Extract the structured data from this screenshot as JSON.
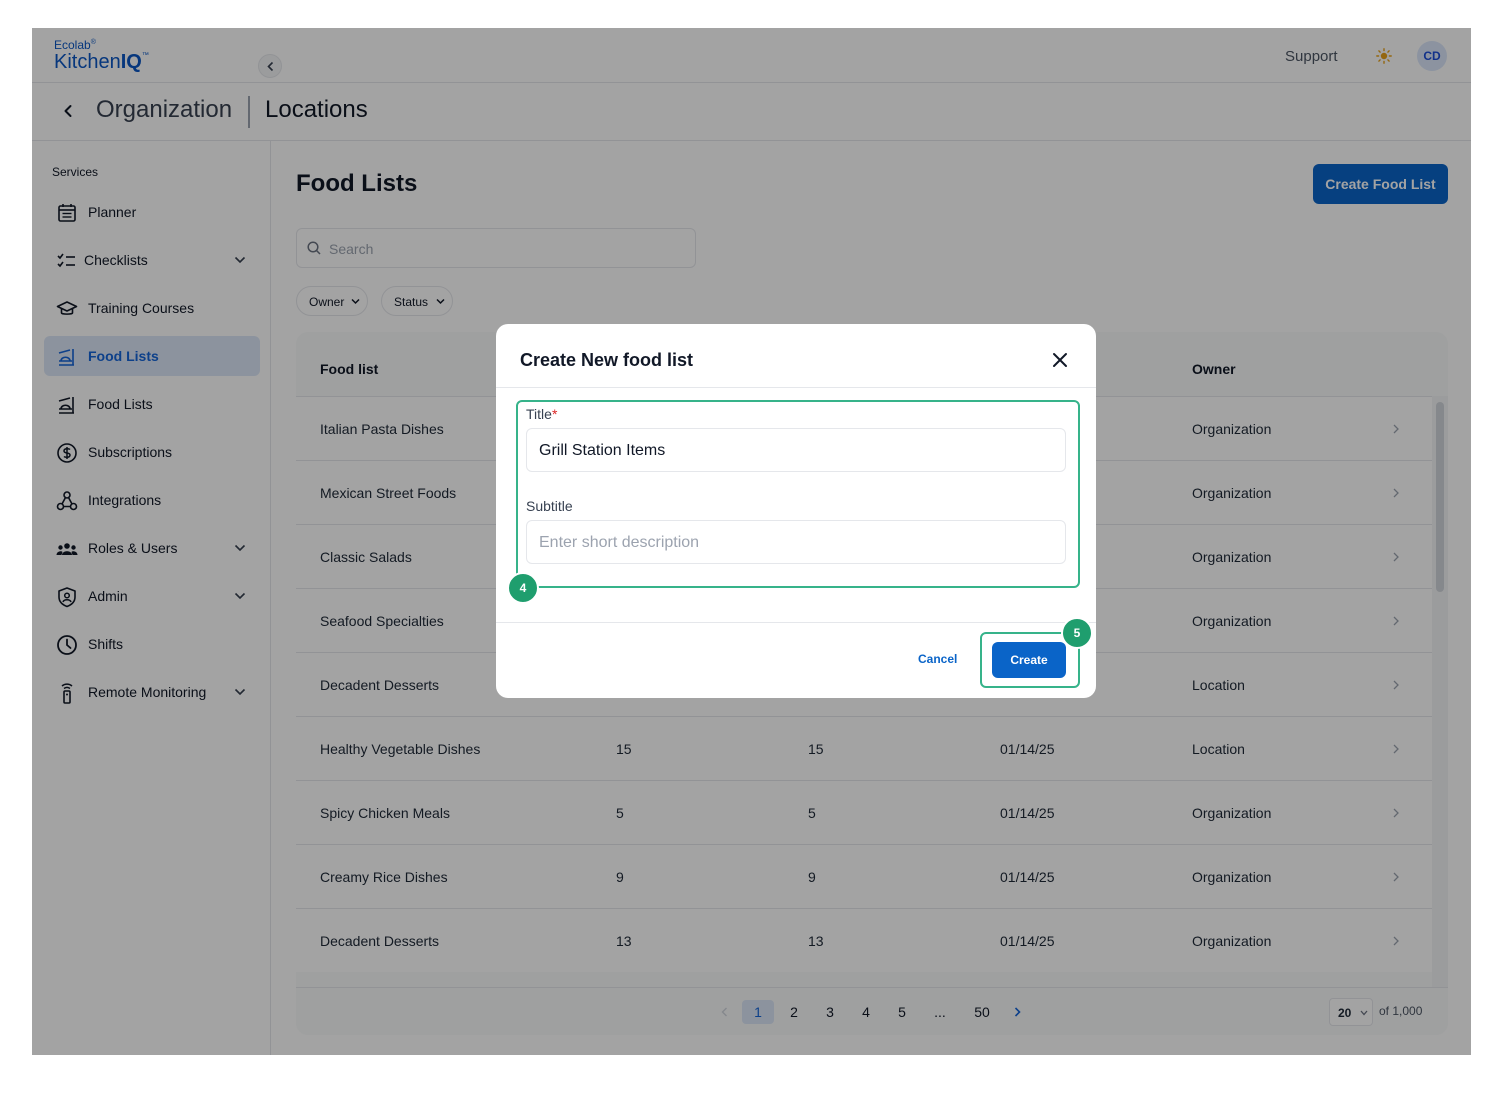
{
  "header": {
    "logo_small": "Ecolab",
    "logo_main": "Kitchen",
    "logo_bold": "IQ",
    "support_label": "Support",
    "avatar_initials": "CD"
  },
  "breadcrumb": {
    "parent": "Organization",
    "current": "Locations"
  },
  "sidebar": {
    "section_label": "Services",
    "items": [
      {
        "label": "Planner",
        "icon": "calendar-icon",
        "expandable": false,
        "active": false
      },
      {
        "label": "Checklists",
        "icon": "checklist-icon",
        "expandable": true,
        "active": false
      },
      {
        "label": "Training Courses",
        "icon": "graduation-cap-icon",
        "expandable": false,
        "active": false
      },
      {
        "label": "Food Lists",
        "icon": "food-list-icon",
        "expandable": false,
        "active": true
      },
      {
        "label": "Food Lists",
        "icon": "food-list-icon",
        "expandable": false,
        "active": false
      },
      {
        "label": "Subscriptions",
        "icon": "dollar-icon",
        "expandable": false,
        "active": false
      },
      {
        "label": "Integrations",
        "icon": "integrations-icon",
        "expandable": false,
        "active": false
      },
      {
        "label": "Roles & Users",
        "icon": "users-icon",
        "expandable": true,
        "active": false
      },
      {
        "label": "Admin",
        "icon": "shield-icon",
        "expandable": true,
        "active": false
      },
      {
        "label": "Shifts",
        "icon": "clock-icon",
        "expandable": false,
        "active": false
      },
      {
        "label": "Remote Monitoring",
        "icon": "sensor-icon",
        "expandable": true,
        "active": false
      }
    ]
  },
  "main": {
    "title": "Food Lists",
    "create_button": "Create Food List",
    "search_placeholder": "Search",
    "filters": [
      "Owner",
      "Status"
    ],
    "table": {
      "columns": [
        "Food list",
        "",
        "",
        "",
        "Owner"
      ],
      "rows": [
        [
          "Italian Pasta Dishes",
          "",
          "",
          "",
          "Organization"
        ],
        [
          "Mexican Street Foods",
          "",
          "",
          "",
          "Organization"
        ],
        [
          "Classic Salads",
          "",
          "",
          "",
          "Organization"
        ],
        [
          "Seafood Specialties",
          "",
          "",
          "",
          "Organization"
        ],
        [
          "Decadent Desserts",
          "",
          "",
          "",
          "Location"
        ],
        [
          "Healthy Vegetable Dishes",
          "15",
          "15",
          "01/14/25",
          "Location"
        ],
        [
          "Spicy Chicken Meals",
          "5",
          "5",
          "01/14/25",
          "Organization"
        ],
        [
          "Creamy Rice Dishes",
          "9",
          "9",
          "01/14/25",
          "Organization"
        ],
        [
          "Decadent Desserts",
          "13",
          "13",
          "01/14/25",
          "Organization"
        ]
      ]
    },
    "pagination": {
      "pages": [
        "1",
        "2",
        "3",
        "4",
        "5",
        "...",
        "50"
      ],
      "current": "1",
      "per_page": "20",
      "total_label": "of 1,000"
    }
  },
  "modal": {
    "title": "Create New food list",
    "title_label": "Title",
    "required_mark": "*",
    "title_value": "Grill Station Items",
    "subtitle_label": "Subtitle",
    "subtitle_placeholder": "Enter short description",
    "cancel_label": "Cancel",
    "create_label": "Create",
    "step_badges": [
      "4",
      "5"
    ]
  },
  "colors": {
    "brand": "#0a64c8",
    "highlight": "#36b38a",
    "badge": "#1f9e6e",
    "active_nav_bg": "#dbe6f7"
  }
}
